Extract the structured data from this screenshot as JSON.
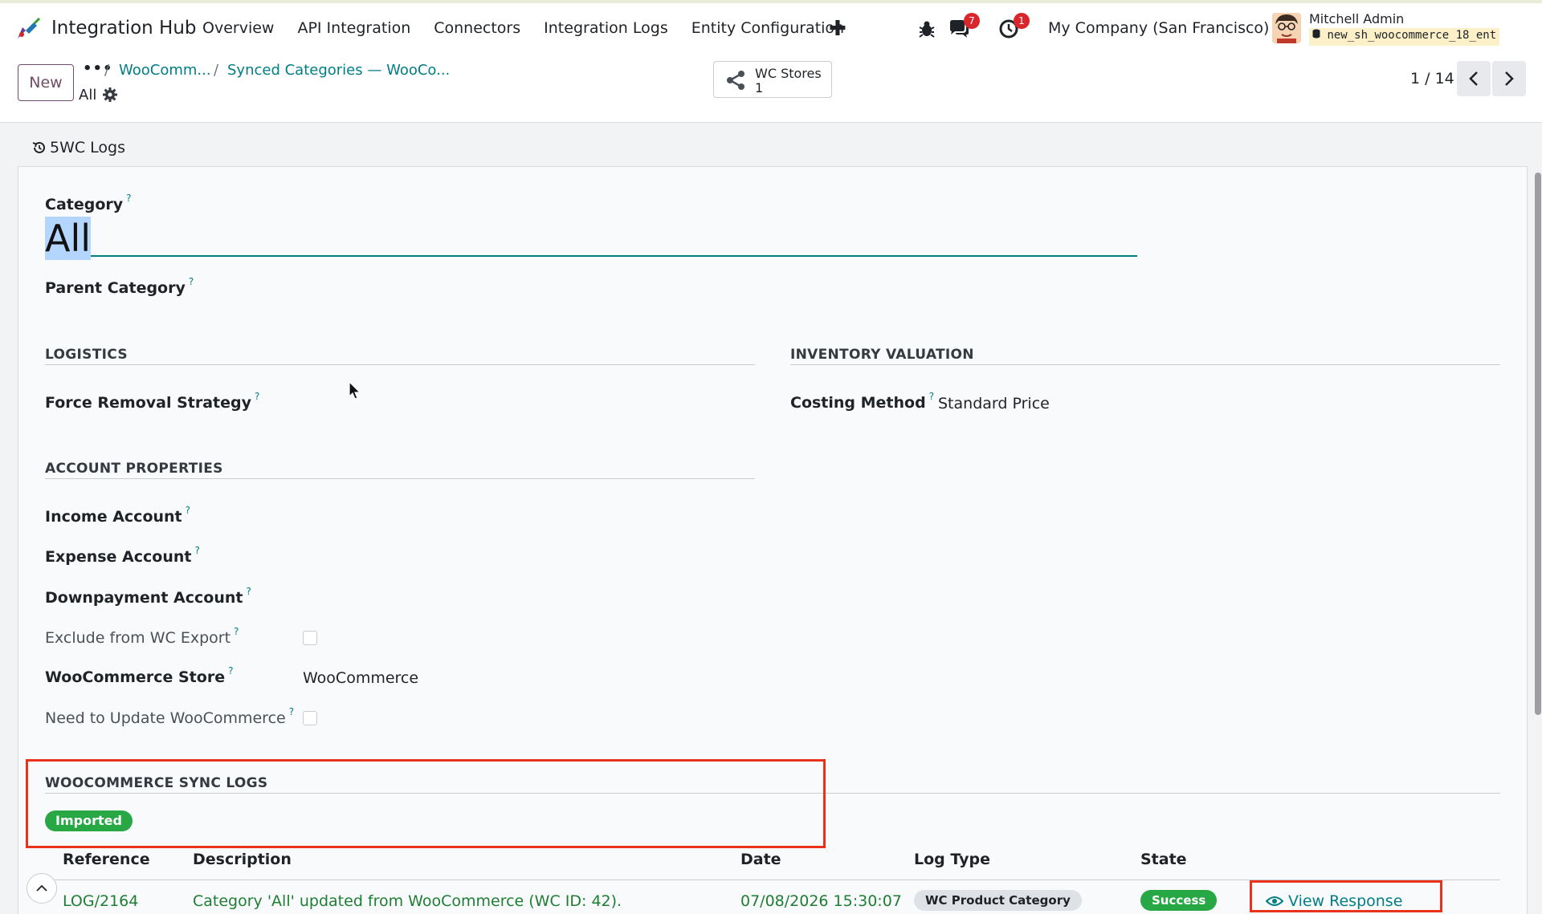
{
  "navbar": {
    "app_name": "Integration Hub",
    "menu": [
      "Overview",
      "API Integration",
      "Connectors",
      "Integration Logs",
      "Entity Configuration"
    ],
    "messages_badge": "7",
    "activities_badge": "1",
    "company": "My Company (San Francisco)",
    "user_name": "Mitchell Admin",
    "database": "new_sh_woocommerce_18_ent"
  },
  "control_panel": {
    "new_label": "New",
    "breadcrumb_dots": "•••",
    "breadcrumb_sep": "/",
    "breadcrumb": [
      "WooComm...",
      "Synced Categories — WooCo..."
    ],
    "current_record": "All",
    "smart_button": {
      "label": "WC Stores",
      "count": "1"
    },
    "pager": "1 / 14"
  },
  "form": {
    "logs_button": "5WC Logs",
    "category_label": "Category",
    "category_value": "All",
    "parent_category_label": "Parent Category",
    "help_mark": "?",
    "logistics": {
      "heading": "LOGISTICS",
      "force_removal_label": "Force Removal Strategy"
    },
    "inventory": {
      "heading": "INVENTORY VALUATION",
      "costing_label": "Costing Method",
      "costing_value": "Standard Price"
    },
    "account": {
      "heading": "ACCOUNT PROPERTIES",
      "income_label": "Income Account",
      "expense_label": "Expense Account",
      "downpayment_label": "Downpayment Account",
      "exclude_label": "Exclude from WC Export",
      "store_label": "WooCommerce Store",
      "store_value": "WooCommerce",
      "need_update_label": "Need to Update WooCommerce"
    },
    "sync_logs": {
      "heading": "WOOCOMMERCE SYNC LOGS",
      "status_tag": "Imported",
      "columns": [
        "Reference",
        "Description",
        "Date",
        "Log Type",
        "State"
      ],
      "rows": [
        {
          "reference": "LOG/2164",
          "description": "Category 'All' updated from WooCommerce (WC ID: 42).",
          "date": "07/08/2026 15:30:07",
          "log_type": "WC Product Category",
          "state": "Success",
          "action": "View Response"
        }
      ]
    }
  },
  "colors": {
    "accent": "#017e84",
    "brand": "#714b67",
    "success": "#28a745",
    "highlight_box": "#e8321b"
  }
}
